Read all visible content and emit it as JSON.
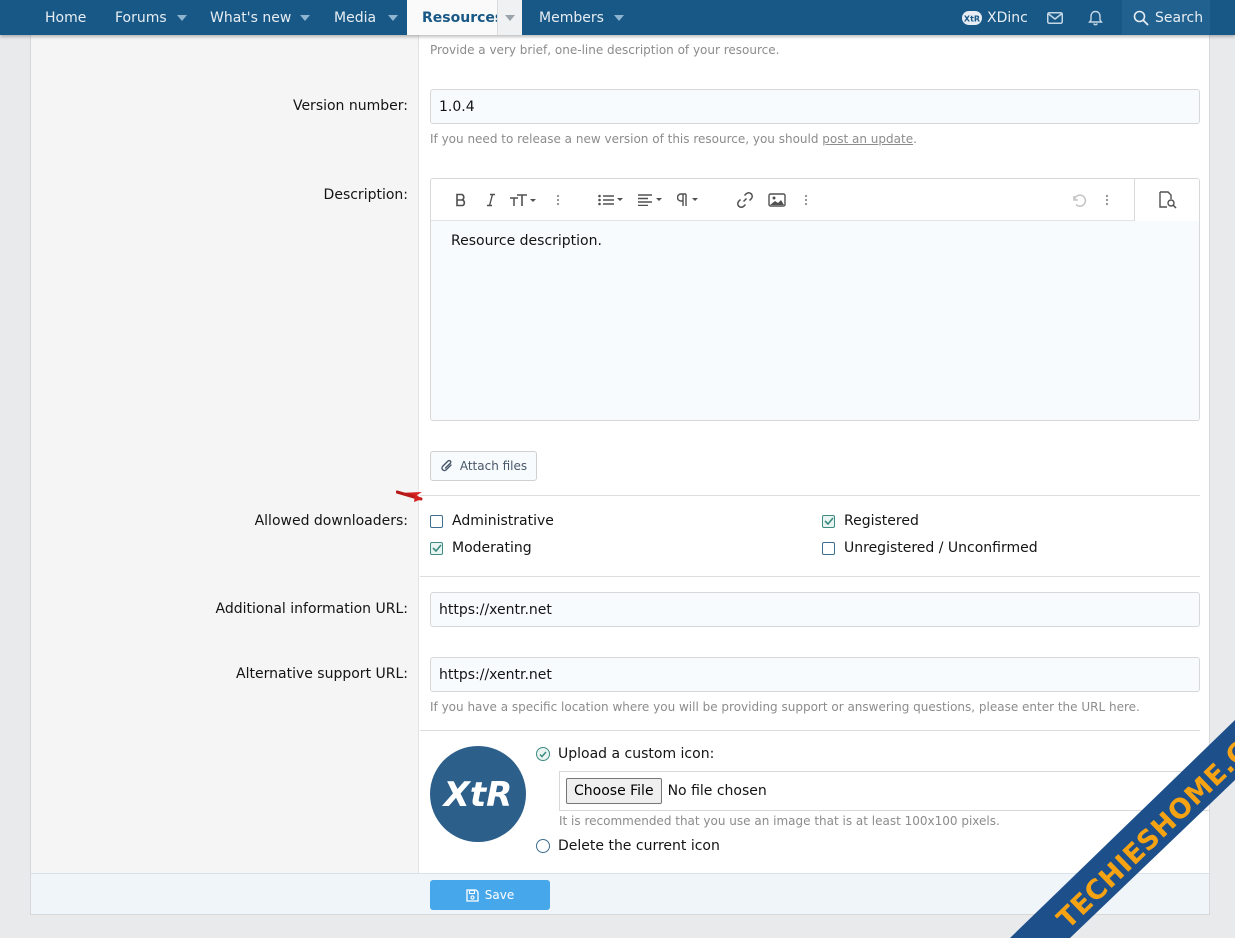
{
  "nav": {
    "home": "Home",
    "forums": "Forums",
    "whats_new": "What's new",
    "media": "Media",
    "resources": "Resources",
    "members": "Members",
    "user": "XDinc",
    "search": "Search"
  },
  "form": {
    "tagline_hint": "Provide a very brief, one-line description of your resource.",
    "version_label": "Version number:",
    "version_value": "1.0.4",
    "version_hint_prefix": "If you need to release a new version of this resource, you should ",
    "version_hint_link": "post an update",
    "version_hint_suffix": ".",
    "description_label": "Description:",
    "description_value": "Resource description.",
    "attach_label": "Attach files",
    "downloaders_label": "Allowed downloaders:",
    "downloaders": [
      {
        "label": "Administrative",
        "checked": false
      },
      {
        "label": "Registered",
        "checked": true
      },
      {
        "label": "Moderating",
        "checked": true
      },
      {
        "label": "Unregistered / Unconfirmed",
        "checked": false
      }
    ],
    "info_url_label": "Additional information URL:",
    "info_url_value": "https://xentr.net",
    "support_url_label": "Alternative support URL:",
    "support_url_value": "https://xentr.net",
    "support_url_hint": "If you have a specific location where you will be providing support or answering questions, please enter the URL here.",
    "icon_upload_label": "Upload a custom icon:",
    "choose_file": "Choose File",
    "no_file": "No file chosen",
    "icon_hint": "It is recommended that you use an image that is at least 100x100 pixels.",
    "icon_delete_label": "Delete the current icon",
    "save": "Save"
  },
  "icons": {
    "bold": "bold-icon",
    "italic": "italic-icon",
    "text_size": "text-size-icon",
    "list": "list-icon",
    "align": "align-icon",
    "paragraph": "paragraph-icon",
    "link": "link-icon",
    "image": "image-icon",
    "undo": "undo-icon",
    "preview": "preview-icon",
    "paperclip": "paperclip-icon",
    "save": "floppy-disk-icon"
  },
  "colors": {
    "nav_bg": "#185886",
    "accent": "#47a7eb",
    "check": "#3c8c82"
  },
  "branding": {
    "logo_text": "XtR",
    "watermark": "TECHIESHOME.COM"
  }
}
